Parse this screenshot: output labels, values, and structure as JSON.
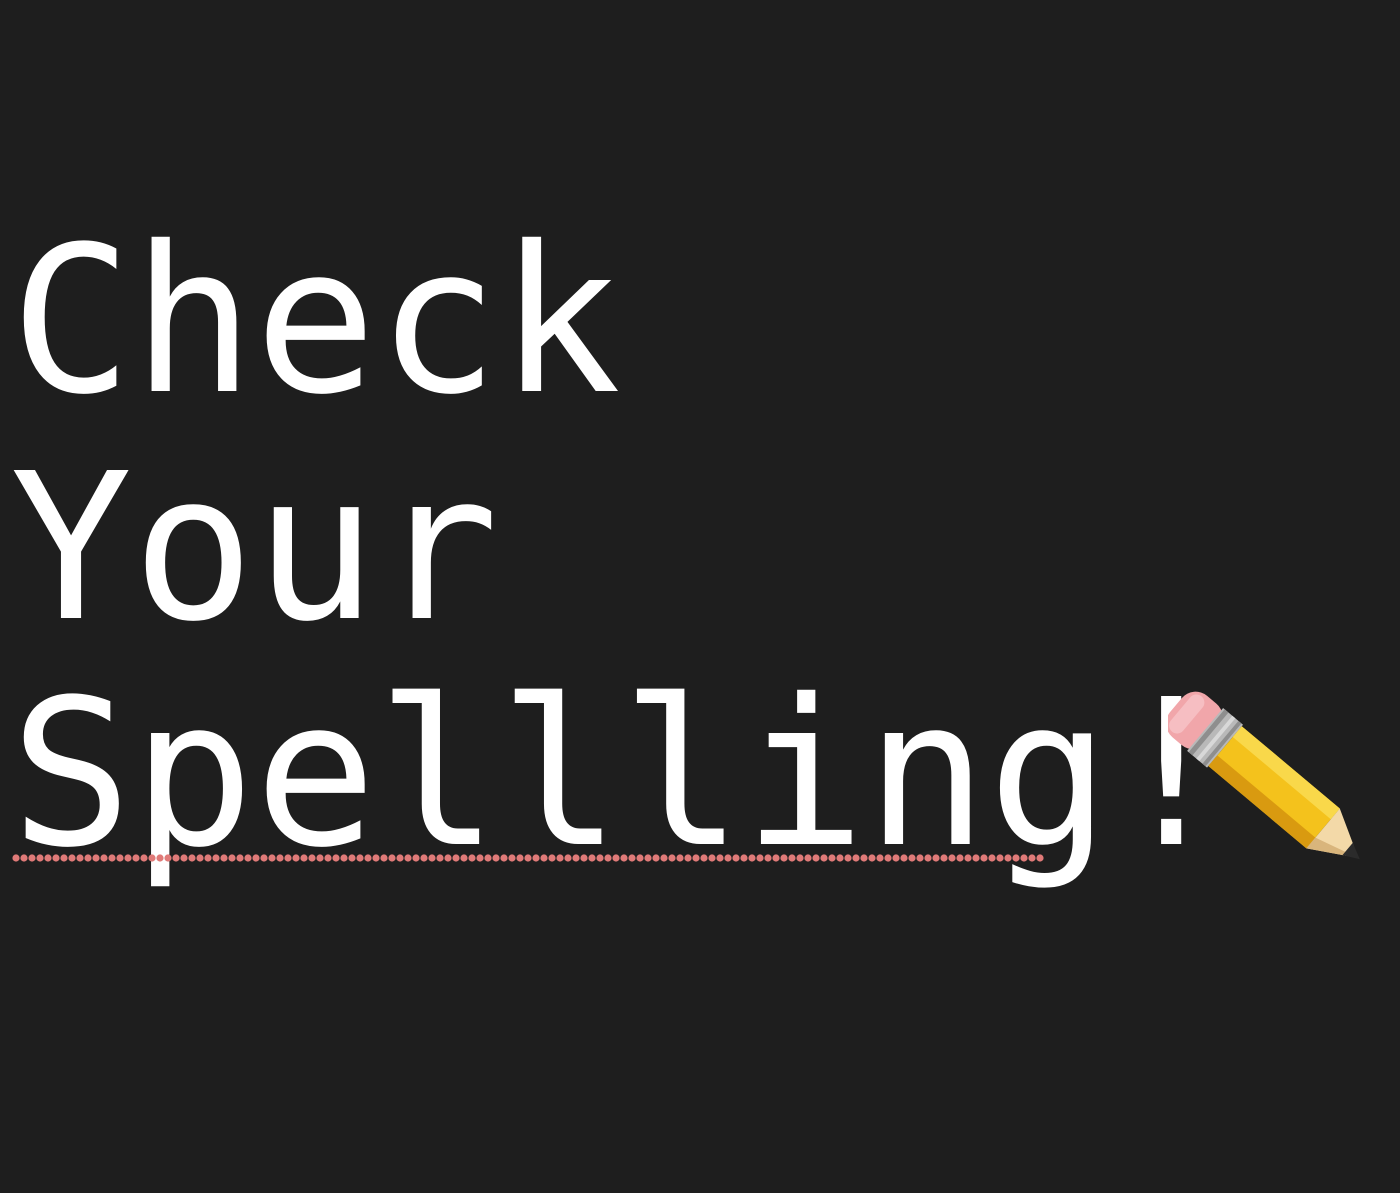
{
  "lines": [
    "Check",
    "Your",
    "Spellling"
  ],
  "exclamation": "!",
  "icons": {
    "pencil": "pencil-icon",
    "spellcheck_underline": "dotted-error-underline"
  },
  "colors": {
    "background": "#1e1e1e",
    "text": "#ffffff",
    "error_underline": "#e07a78",
    "pencil_body": "#f4c21c",
    "pencil_eraser": "#f1a6aa"
  }
}
